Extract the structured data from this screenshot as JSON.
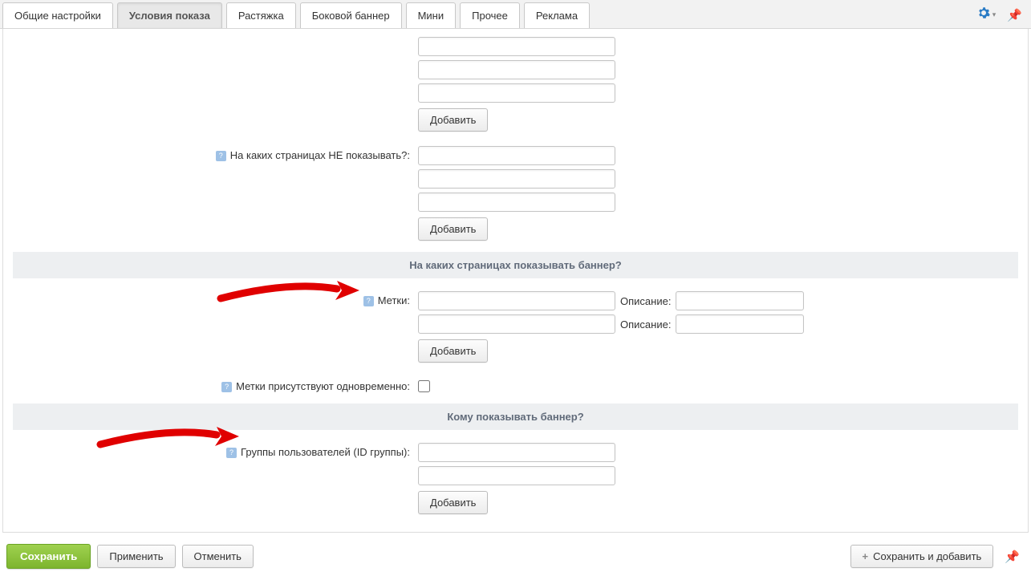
{
  "tabs": [
    {
      "label": "Общие настройки"
    },
    {
      "label": "Условия показа"
    },
    {
      "label": "Растяжка"
    },
    {
      "label": "Боковой баннер"
    },
    {
      "label": "Мини"
    },
    {
      "label": "Прочее"
    },
    {
      "label": "Реклама"
    }
  ],
  "labels": {
    "dont_show_pages": "На каких страницах НЕ показывать?:",
    "tags": "Метки:",
    "desc": "Описание:",
    "tags_together": "Метки присутствуют одновременно:",
    "user_groups": "Группы пользователей (ID группы):"
  },
  "sections": {
    "pages": "На каких страницах показывать баннер?",
    "who": "Кому показывать баннер?"
  },
  "buttons": {
    "add": "Добавить",
    "save": "Сохранить",
    "apply": "Применить",
    "cancel": "Отменить",
    "save_and_add": "Сохранить и добавить"
  }
}
